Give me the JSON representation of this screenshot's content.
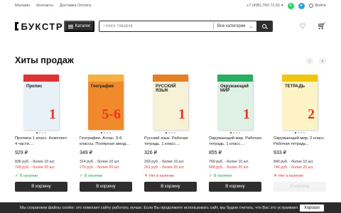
{
  "topbar": {
    "links": [
      "Магазин",
      "Контакты",
      "Доставка Оплата"
    ],
    "phone": "+7 (495) 760-71-91",
    "phone_chevron": "▾",
    "login": "Войти"
  },
  "header": {
    "logo": "БУКСТР",
    "catalog_label": "Каталог",
    "search_placeholder": "Поиск товаров",
    "search_category": "Все категории",
    "search_category_chevron": "⌄"
  },
  "section": {
    "title": "Хиты продаж",
    "prev_arrow": "‹",
    "next_arrow": "›"
  },
  "products": [
    {
      "title": "Прописи 1 класс. Комплект 4 части....",
      "price": "929 ₽",
      "bulk1": "836 руб. - более 10 шт.",
      "bulk2": "743 руб. - более 20 шт.",
      "stock": "В наличии",
      "in_stock": true,
      "button": "В корзину",
      "cover_color": "#e8f0f8",
      "band_color": "#d33",
      "cover_title": "Пропис",
      "cover_num": "1"
    },
    {
      "title": "География. Атлас. 5-6 классы. Полярная звезд...",
      "price": "349 ₽",
      "bulk1": "314 руб. - более 10 шт.",
      "bulk2": "279 руб. - более 20 шт.",
      "stock": "В наличии",
      "in_stock": true,
      "button": "В корзину",
      "cover_color": "#f08a2a",
      "band_color": "#f5b041",
      "cover_title": "География",
      "cover_num": "5-6"
    },
    {
      "title": "Русский язык. Рабочая тетрадь. 1 класс....",
      "price": "326 ₽",
      "bulk1": "293 руб. - более 10 шт.",
      "bulk2": "261 руб. - более 20 шт.",
      "stock": "Нет в наличии",
      "in_stock": false,
      "button": "В корзину",
      "cover_color": "#f7f1d8",
      "band_color": "#e67e22",
      "cover_title": "РУССКИЙ ЯЗЫК",
      "cover_num": "1"
    },
    {
      "title": "Окружающий мир. Рабочая тетрадь. 1 класс....",
      "price": "855 ₽",
      "bulk1": "769 руб. - более 10 шт.",
      "bulk2": "684 руб. - более 20 шт.",
      "stock": "В наличии",
      "in_stock": true,
      "button": "В корзину",
      "cover_color": "#dff1e4",
      "band_color": "#27ae60",
      "cover_title": "Окружающий МИР",
      "cover_num": "1"
    },
    {
      "title": "Окружающий мир. 2 класс. Рабочая тетрадь...",
      "price": "933 ₽",
      "bulk1": "840 руб. - более 10 шт.",
      "bulk2": "746 руб. - более 20 шт.",
      "stock": "Нет в наличии",
      "in_stock": false,
      "button": "В корзину",
      "cover_color": "#fdf3c4",
      "band_color": "#f1c40f",
      "cover_title": "ТЕТРАДЬ",
      "cover_num": "2"
    }
  ],
  "cookie": {
    "text": "Мы сохраняем файлы cookie: это помогает сайту работать лучше. Если Вы продолжите использовать сайт, мы будем считать, что Вас это устраивает.",
    "ok": "Хорошо"
  }
}
